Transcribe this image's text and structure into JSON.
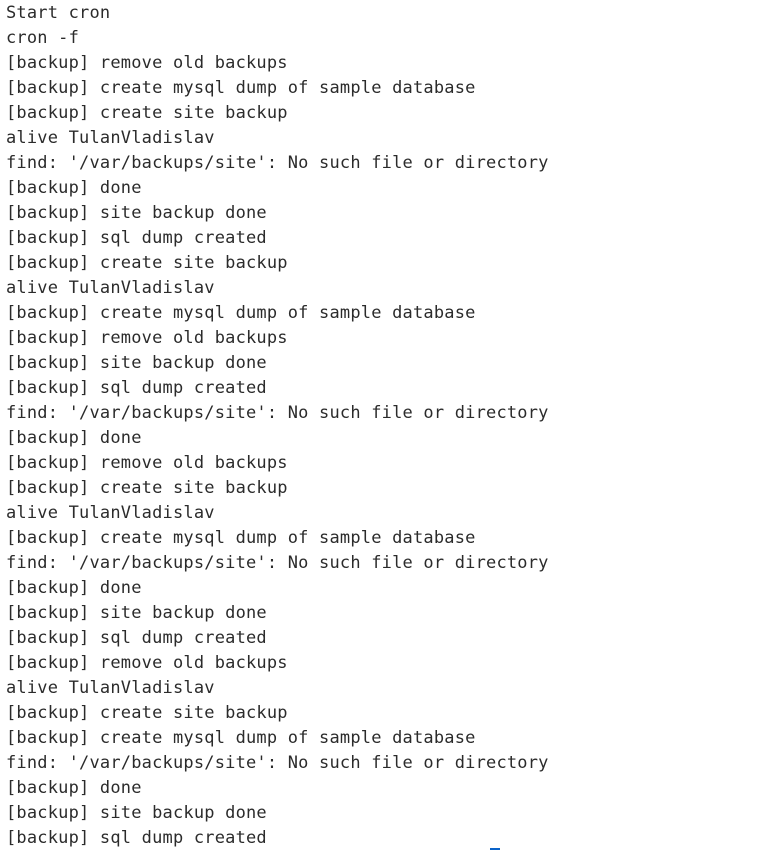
{
  "terminal": {
    "lines": [
      "Start cron",
      "cron -f",
      "[backup] remove old backups",
      "[backup] create mysql dump of sample database",
      "[backup] create site backup",
      "alive TulanVladislav",
      "find: '/var/backups/site': No such file or directory",
      "[backup] done",
      "[backup] site backup done",
      "[backup] sql dump created",
      "[backup] create site backup",
      "alive TulanVladislav",
      "[backup] create mysql dump of sample database",
      "[backup] remove old backups",
      "[backup] site backup done",
      "[backup] sql dump created",
      "find: '/var/backups/site': No such file or directory",
      "[backup] done",
      "[backup] remove old backups",
      "[backup] create site backup",
      "alive TulanVladislav",
      "[backup] create mysql dump of sample database",
      "find: '/var/backups/site': No such file or directory",
      "[backup] done",
      "[backup] site backup done",
      "[backup] sql dump created",
      "[backup] remove old backups",
      "alive TulanVladislav",
      "[backup] create site backup",
      "[backup] create mysql dump of sample database",
      "find: '/var/backups/site': No such file or directory",
      "[backup] done",
      "[backup] site backup done",
      "[backup] sql dump created"
    ],
    "text_color": "#2b2b2b",
    "background_color": "#ffffff",
    "cursor_color": "#0a63c9"
  }
}
